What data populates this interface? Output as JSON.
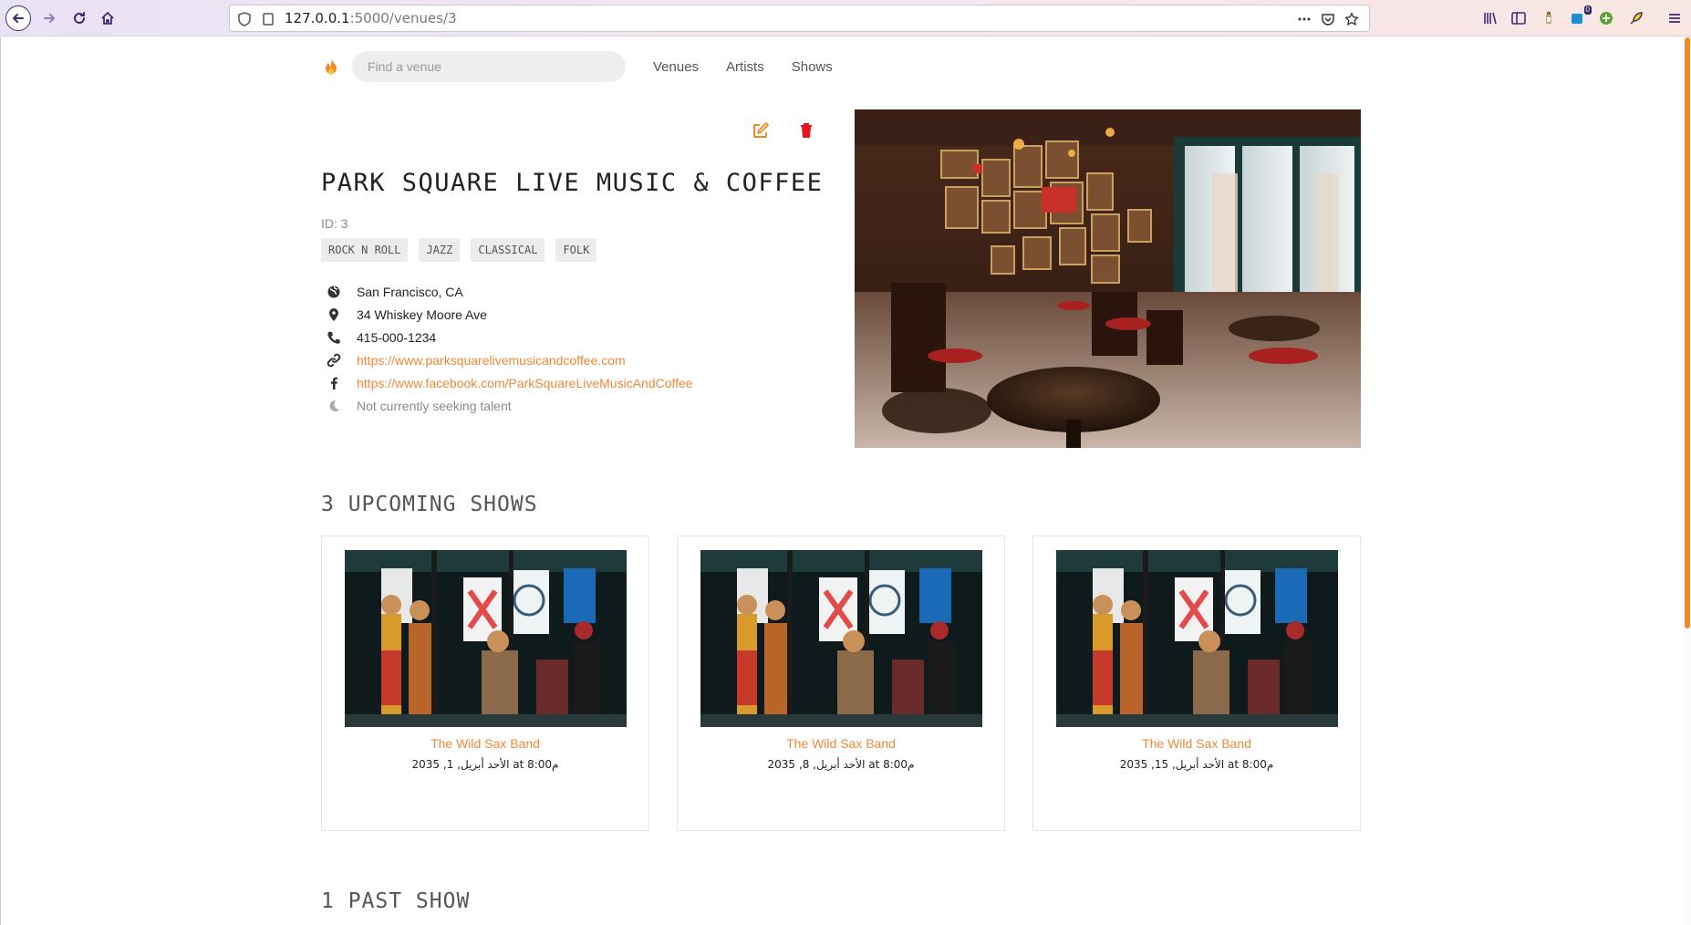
{
  "browser": {
    "url_host": "127.0.0.1",
    "url_rest": ":5000/venues/3",
    "notification_count": "0"
  },
  "nav": {
    "search_placeholder": "Find a venue",
    "links": [
      "Venues",
      "Artists",
      "Shows"
    ]
  },
  "venue": {
    "name": "PARK SQUARE LIVE MUSIC & COFFEE",
    "id_label": "ID: 3",
    "genres": [
      "ROCK N ROLL",
      "JAZZ",
      "CLASSICAL",
      "FOLK"
    ],
    "city_state": "San Francisco, CA",
    "address": "34 Whiskey Moore Ave",
    "phone": "415-000-1234",
    "website": "https://www.parksquarelivemusicandcoffee.com",
    "facebook": "https://www.facebook.com/ParkSquareLiveMusicAndCoffee",
    "seeking": "Not currently seeking talent"
  },
  "upcoming": {
    "title": "3 UPCOMING SHOWS",
    "shows": [
      {
        "artist": "The Wild Sax Band",
        "date": "الأحد أبريل, 1, 2035 at 8:00م"
      },
      {
        "artist": "The Wild Sax Band",
        "date": "الأحد أبريل, 8, 2035 at 8:00م"
      },
      {
        "artist": "The Wild Sax Band",
        "date": "الأحد أبريل, 15, 2035 at 8:00م"
      }
    ]
  },
  "past": {
    "title": "1 PAST SHOW"
  },
  "colors": {
    "accent": "#f0893a",
    "delete": "#e8141e",
    "text": "#222222"
  }
}
